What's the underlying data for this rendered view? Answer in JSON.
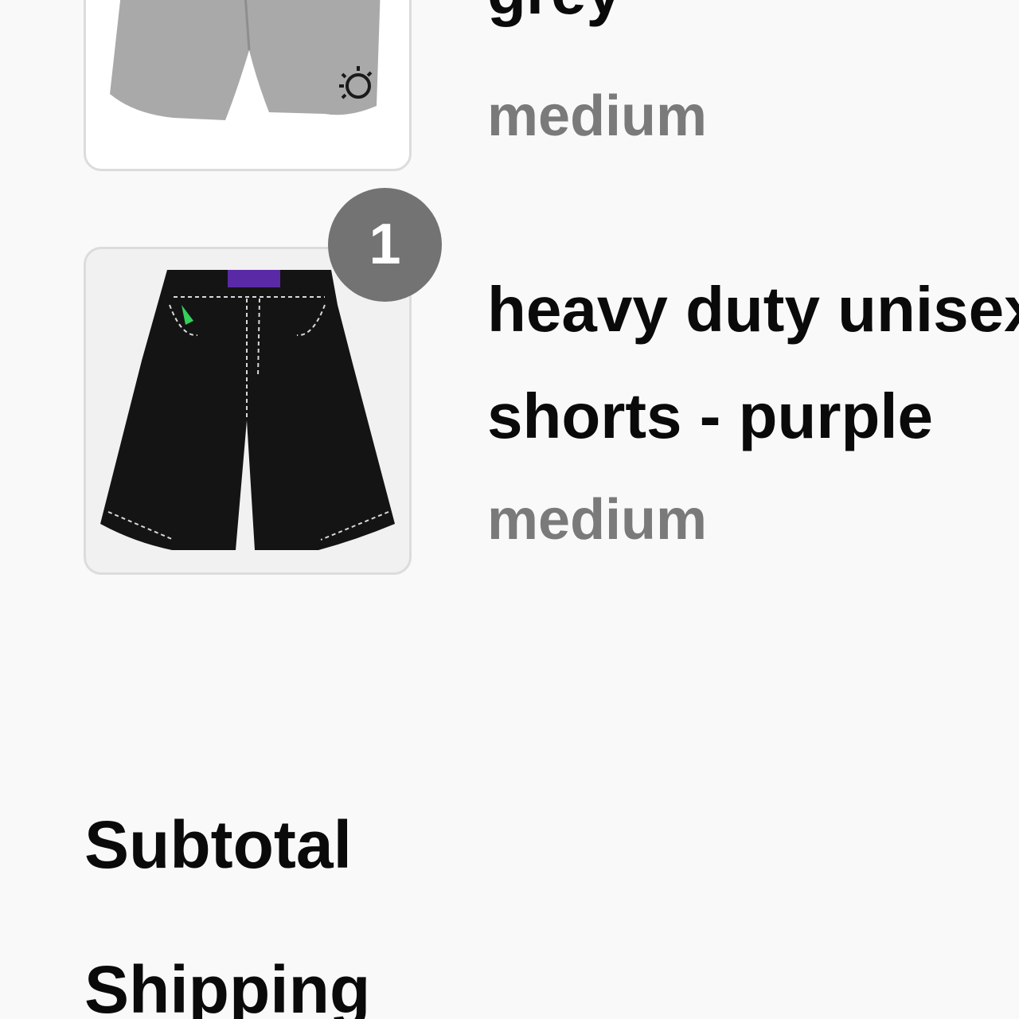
{
  "cart": {
    "items": [
      {
        "title": "grey",
        "variant": "medium",
        "image_icon": "grey-shorts-image"
      },
      {
        "title": "heavy duty unisex shorts - purple",
        "variant": "medium",
        "quantity": "1",
        "image_icon": "black-denim-shorts-image"
      }
    ]
  },
  "summary": {
    "subtotal_label": "Subtotal",
    "shipping_label": "Shipping"
  },
  "colors": {
    "background": "#f9f9f9",
    "badge": "#737373",
    "variant_text": "#7a7a7a",
    "title_text": "#0a0a0a"
  }
}
